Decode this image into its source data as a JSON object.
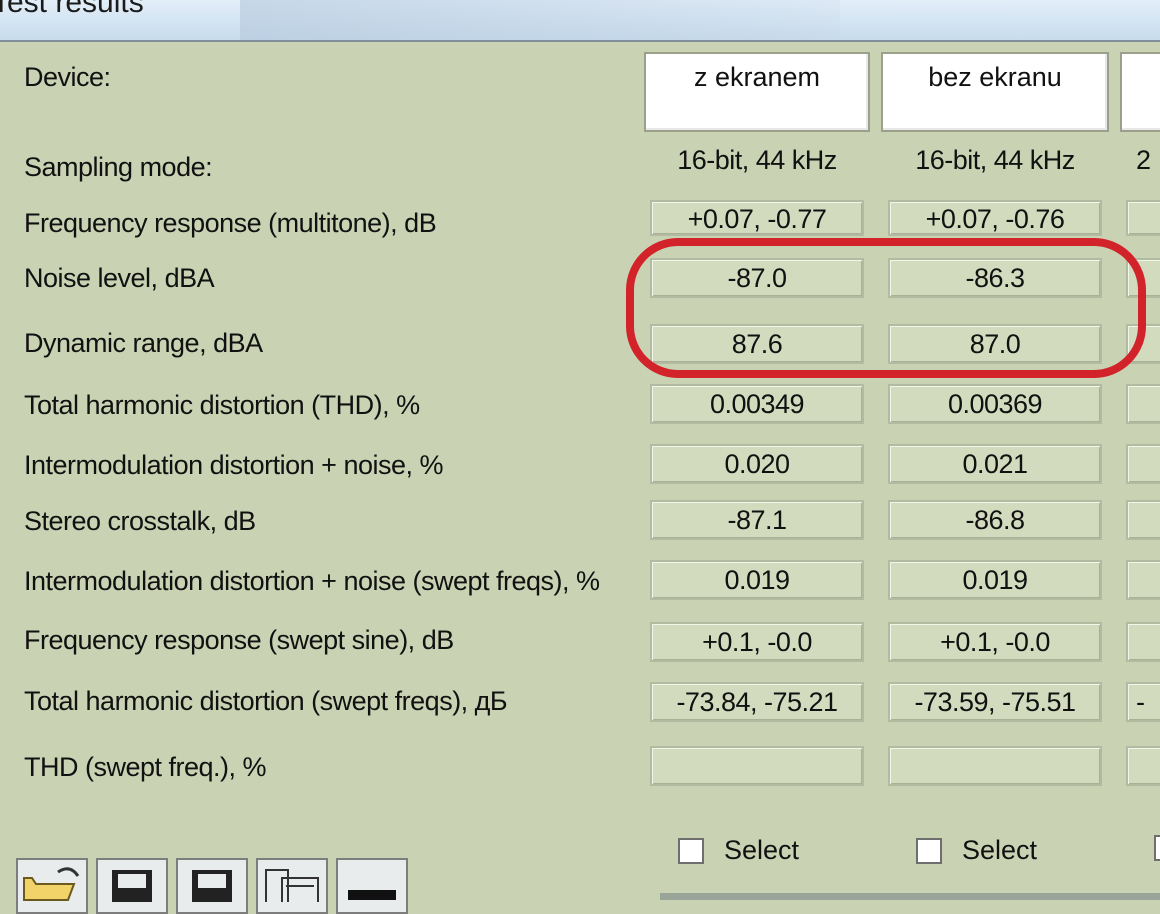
{
  "window": {
    "title": "Test results"
  },
  "columns": [
    {
      "device": "z ekranem",
      "sampling": "16-bit, 44 kHz",
      "values": [
        "+0.07, -0.77",
        "-87.0",
        "87.6",
        "0.00349",
        "0.020",
        "-87.1",
        "0.019",
        "+0.1, -0.0",
        "-73.84, -75.21",
        ""
      ],
      "select_label": "Select"
    },
    {
      "device": "bez ekranu",
      "sampling": "16-bit, 44 kHz",
      "values": [
        "+0.07, -0.76",
        "-86.3",
        "87.0",
        "0.00369",
        "0.021",
        "-86.8",
        "0.019",
        "+0.1, -0.0",
        "-73.59, -75.51",
        ""
      ],
      "select_label": "Select"
    },
    {
      "device": "",
      "sampling": "2",
      "values": [
        "",
        "",
        "",
        "",
        "",
        "",
        "",
        "",
        "-",
        ""
      ],
      "select_label": ""
    }
  ],
  "labels": {
    "device": "Device:",
    "sampling": "Sampling mode:",
    "rows": [
      "Frequency response (multitone), dB",
      "Noise level, dBA",
      "Dynamic range, dBA",
      "Total harmonic distortion (THD), %",
      "Intermodulation distortion + noise, %",
      "Stereo crosstalk, dB",
      "Intermodulation distortion + noise (swept freqs), %",
      "Frequency response (swept sine), dB",
      "Total harmonic distortion (swept freqs), дБ",
      "THD (swept freq.), %"
    ]
  },
  "toolbar": {
    "buttons": [
      "open-folder-icon",
      "save-icon",
      "save-as-icon",
      "copy-icon",
      "minimize-icon"
    ]
  },
  "annotation": {
    "color": "#d2232a"
  }
}
